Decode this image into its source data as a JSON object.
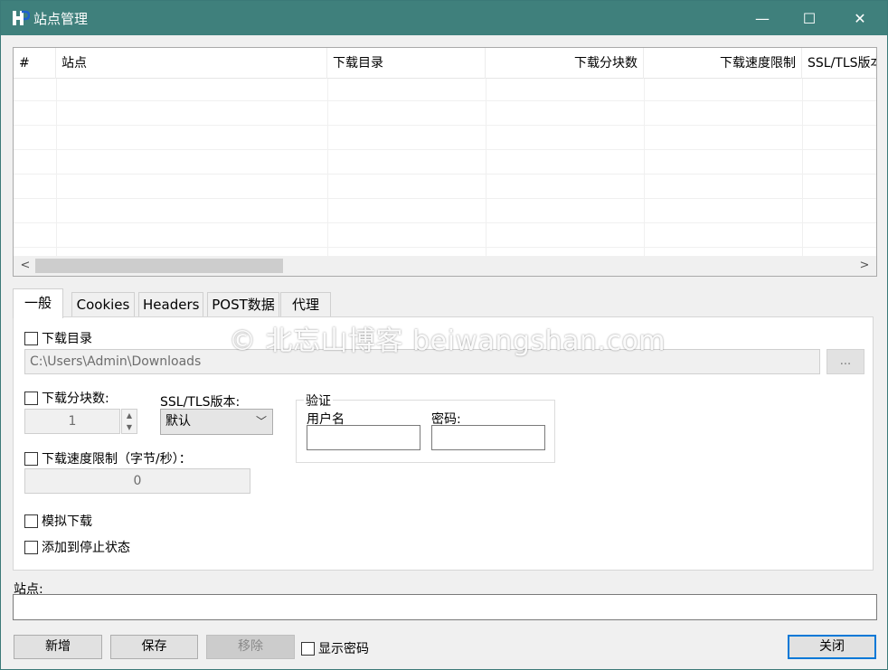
{
  "window": {
    "title": "站点管理",
    "minimize_glyph": "—",
    "maximize_glyph": "☐",
    "close_glyph": "✕",
    "accent": "#3f807c"
  },
  "grid": {
    "columns": [
      "#",
      "站点",
      "下载目录",
      "下载分块数",
      "下载速度限制",
      "SSL/TLS版本"
    ],
    "rows": [],
    "scroll_left_glyph": "<",
    "scroll_right_glyph": ">"
  },
  "tabs": [
    "一般",
    "Cookies",
    "Headers",
    "POST数据",
    "代理"
  ],
  "general": {
    "download_dir_label": "下载目录",
    "download_dir_value": "C:\\Users\\Admin\\Downloads",
    "browse_label": "...",
    "chunks_label": "下载分块数:",
    "chunks_value": "1",
    "ssl_label": "SSL/TLS版本:",
    "ssl_selected": "默认",
    "speed_label": "下载速度限制（字节/秒）：",
    "speed_value": "0",
    "auth_legend": "验证",
    "username_label": "用户名",
    "password_label": "密码:",
    "simulate_label": "模拟下载",
    "add_stopped_label": "添加到停止状态"
  },
  "watermark": "© 北忘山博客 beiwangshan.com",
  "site_label": "站点:",
  "buttons": {
    "add": "新增",
    "save": "保存",
    "remove": "移除",
    "show_password": "显示密码",
    "close": "关闭"
  }
}
